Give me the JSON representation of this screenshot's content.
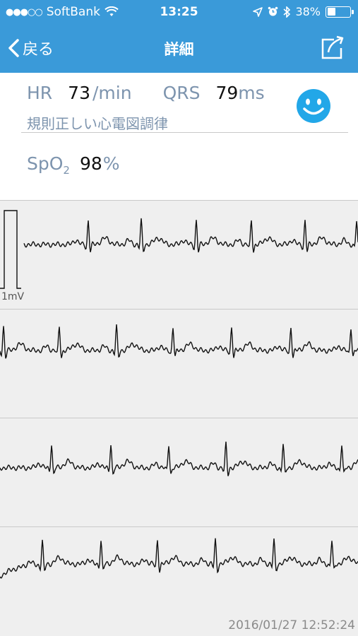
{
  "status_bar": {
    "signal": "●●●○○",
    "carrier": "SoftBank",
    "wifi_icon": "wifi-icon",
    "time": "13:25",
    "battery": "38%",
    "battery_level": 0.38
  },
  "nav": {
    "back_label": "戻る",
    "title": "詳細"
  },
  "readings": {
    "hr_label": "HR",
    "hr_value": "73",
    "hr_unit": "/min",
    "qrs_label": "QRS",
    "qrs_value": "79",
    "qrs_unit": "ms",
    "status": "規則正しい心電図調律",
    "spo2_label": "SpO",
    "spo2_sub": "2",
    "spo2_value": "98",
    "spo2_unit": "%"
  },
  "ecg": {
    "calibration_label": "1mV",
    "timestamp": "2016/01/27 12:52:24",
    "strips": [
      {
        "beats": [
          125,
          200,
          278,
          356,
          432,
          505
        ]
      },
      {
        "beats": [
          5,
          84,
          165,
          245,
          328,
          412,
          497
        ]
      },
      {
        "beats": [
          73,
          157,
          239,
          320,
          401,
          484
        ]
      },
      {
        "beats": [
          60,
          143,
          223,
          305,
          388,
          470
        ]
      }
    ]
  }
}
